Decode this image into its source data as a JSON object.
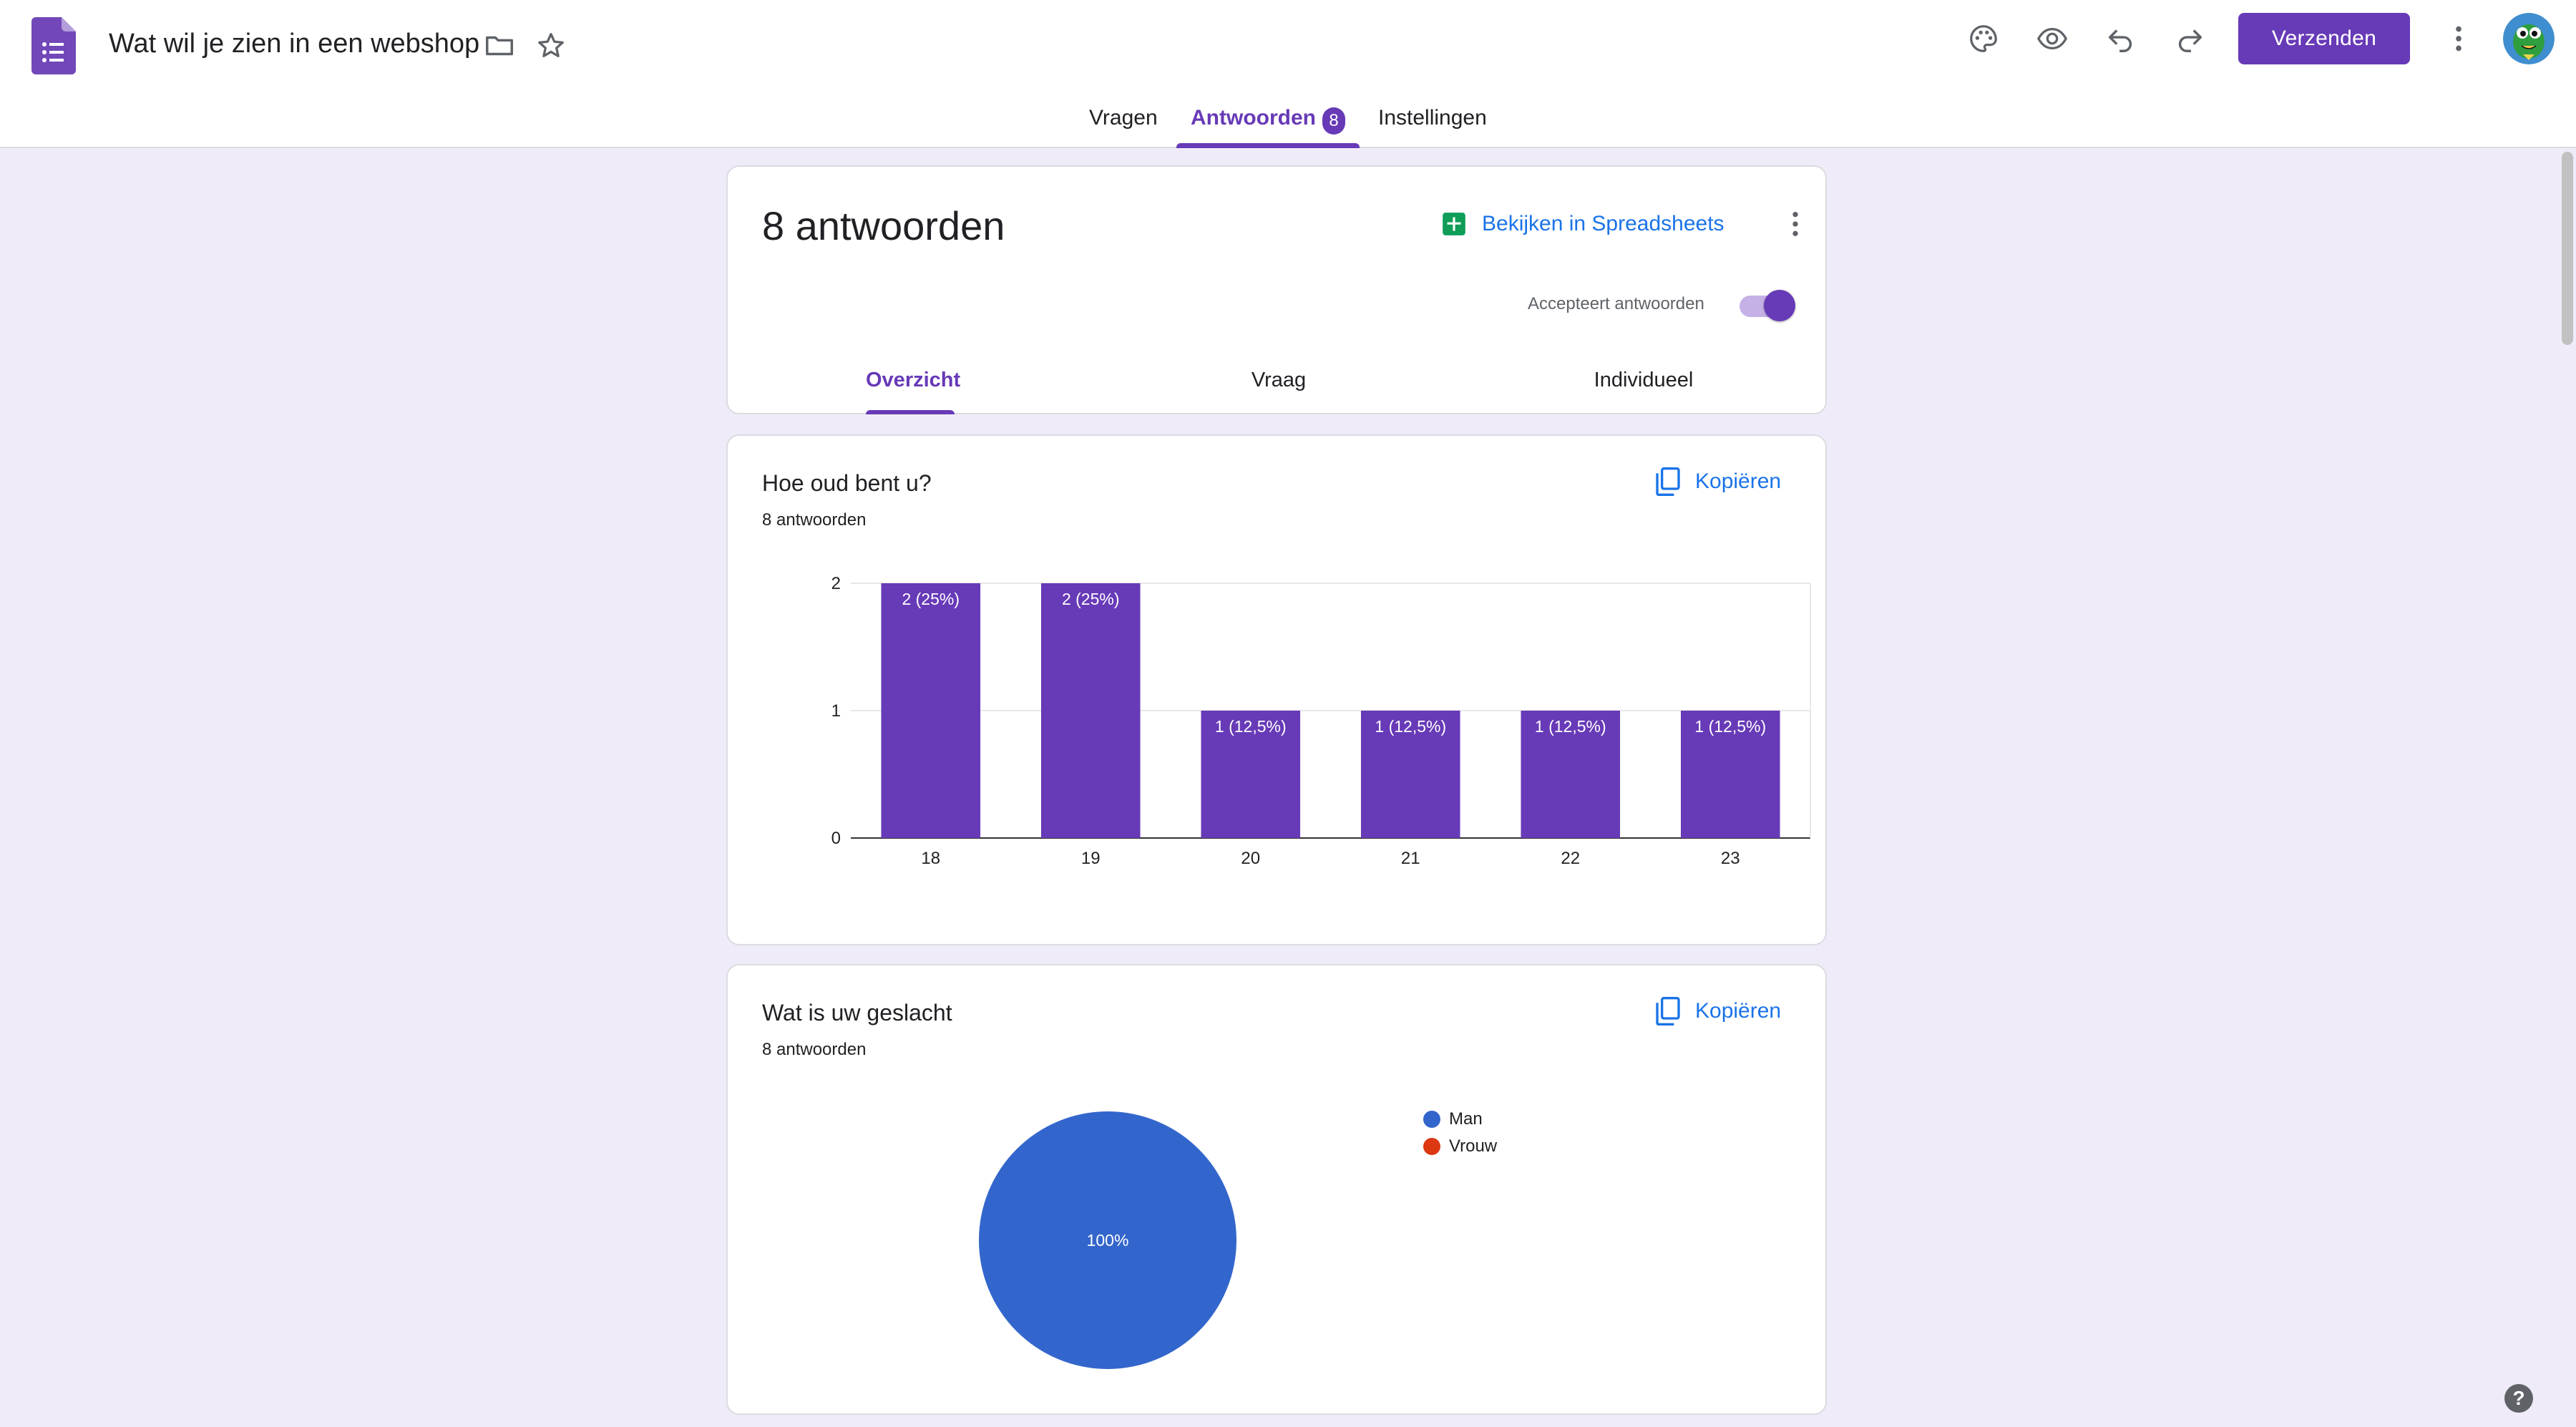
{
  "header": {
    "title": "Wat wil je zien in een webshop",
    "send_label": "Verzenden",
    "icons": [
      "forms-logo-icon",
      "folder-icon",
      "star-icon",
      "palette-icon",
      "preview-eye-icon",
      "undo-icon",
      "redo-icon",
      "more-vert-icon",
      "avatar"
    ]
  },
  "tabs": {
    "questions": "Vragen",
    "responses": "Antwoorden",
    "responses_badge": "8",
    "settings": "Instellingen",
    "active": "Antwoorden"
  },
  "summary": {
    "count_title": "8 antwoorden",
    "sheets_label": "Bekijken in Spreadsheets",
    "accepting_label": "Accepteert antwoorden",
    "accepting": true,
    "subtabs": {
      "overview": "Overzicht",
      "question": "Vraag",
      "individual": "Individueel",
      "active": "Overzicht"
    }
  },
  "questions": [
    {
      "title": "Hoe oud bent u?",
      "count": "8 antwoorden",
      "copy_label": "Kopiëren"
    },
    {
      "title": "Wat is uw geslacht",
      "count": "8 antwoorden",
      "copy_label": "Kopiëren"
    }
  ],
  "chart_data": [
    {
      "type": "bar",
      "categories": [
        "18",
        "19",
        "20",
        "21",
        "22",
        "23"
      ],
      "values": [
        2,
        2,
        1,
        1,
        1,
        1
      ],
      "data_labels": [
        "2 (25%)",
        "2 (25%)",
        "1 (12,5%)",
        "1 (12,5%)",
        "1 (12,5%)",
        "1 (12,5%)"
      ],
      "yticks": [
        "0",
        "1",
        "2"
      ],
      "ylim": [
        0,
        2
      ],
      "grid": true,
      "color": "#673ab7"
    },
    {
      "type": "pie",
      "series": [
        {
          "name": "Man",
          "value": 100,
          "color": "#3366cc"
        },
        {
          "name": "Vrouw",
          "value": 0,
          "color": "#dc3912"
        }
      ],
      "slice_labels": [
        "100%"
      ],
      "legend": "right"
    }
  ],
  "colors": {
    "accent": "#673ab7",
    "background": "#f0ebf8",
    "link": "#1a73e8",
    "sheets_green": "#0f9d58"
  }
}
